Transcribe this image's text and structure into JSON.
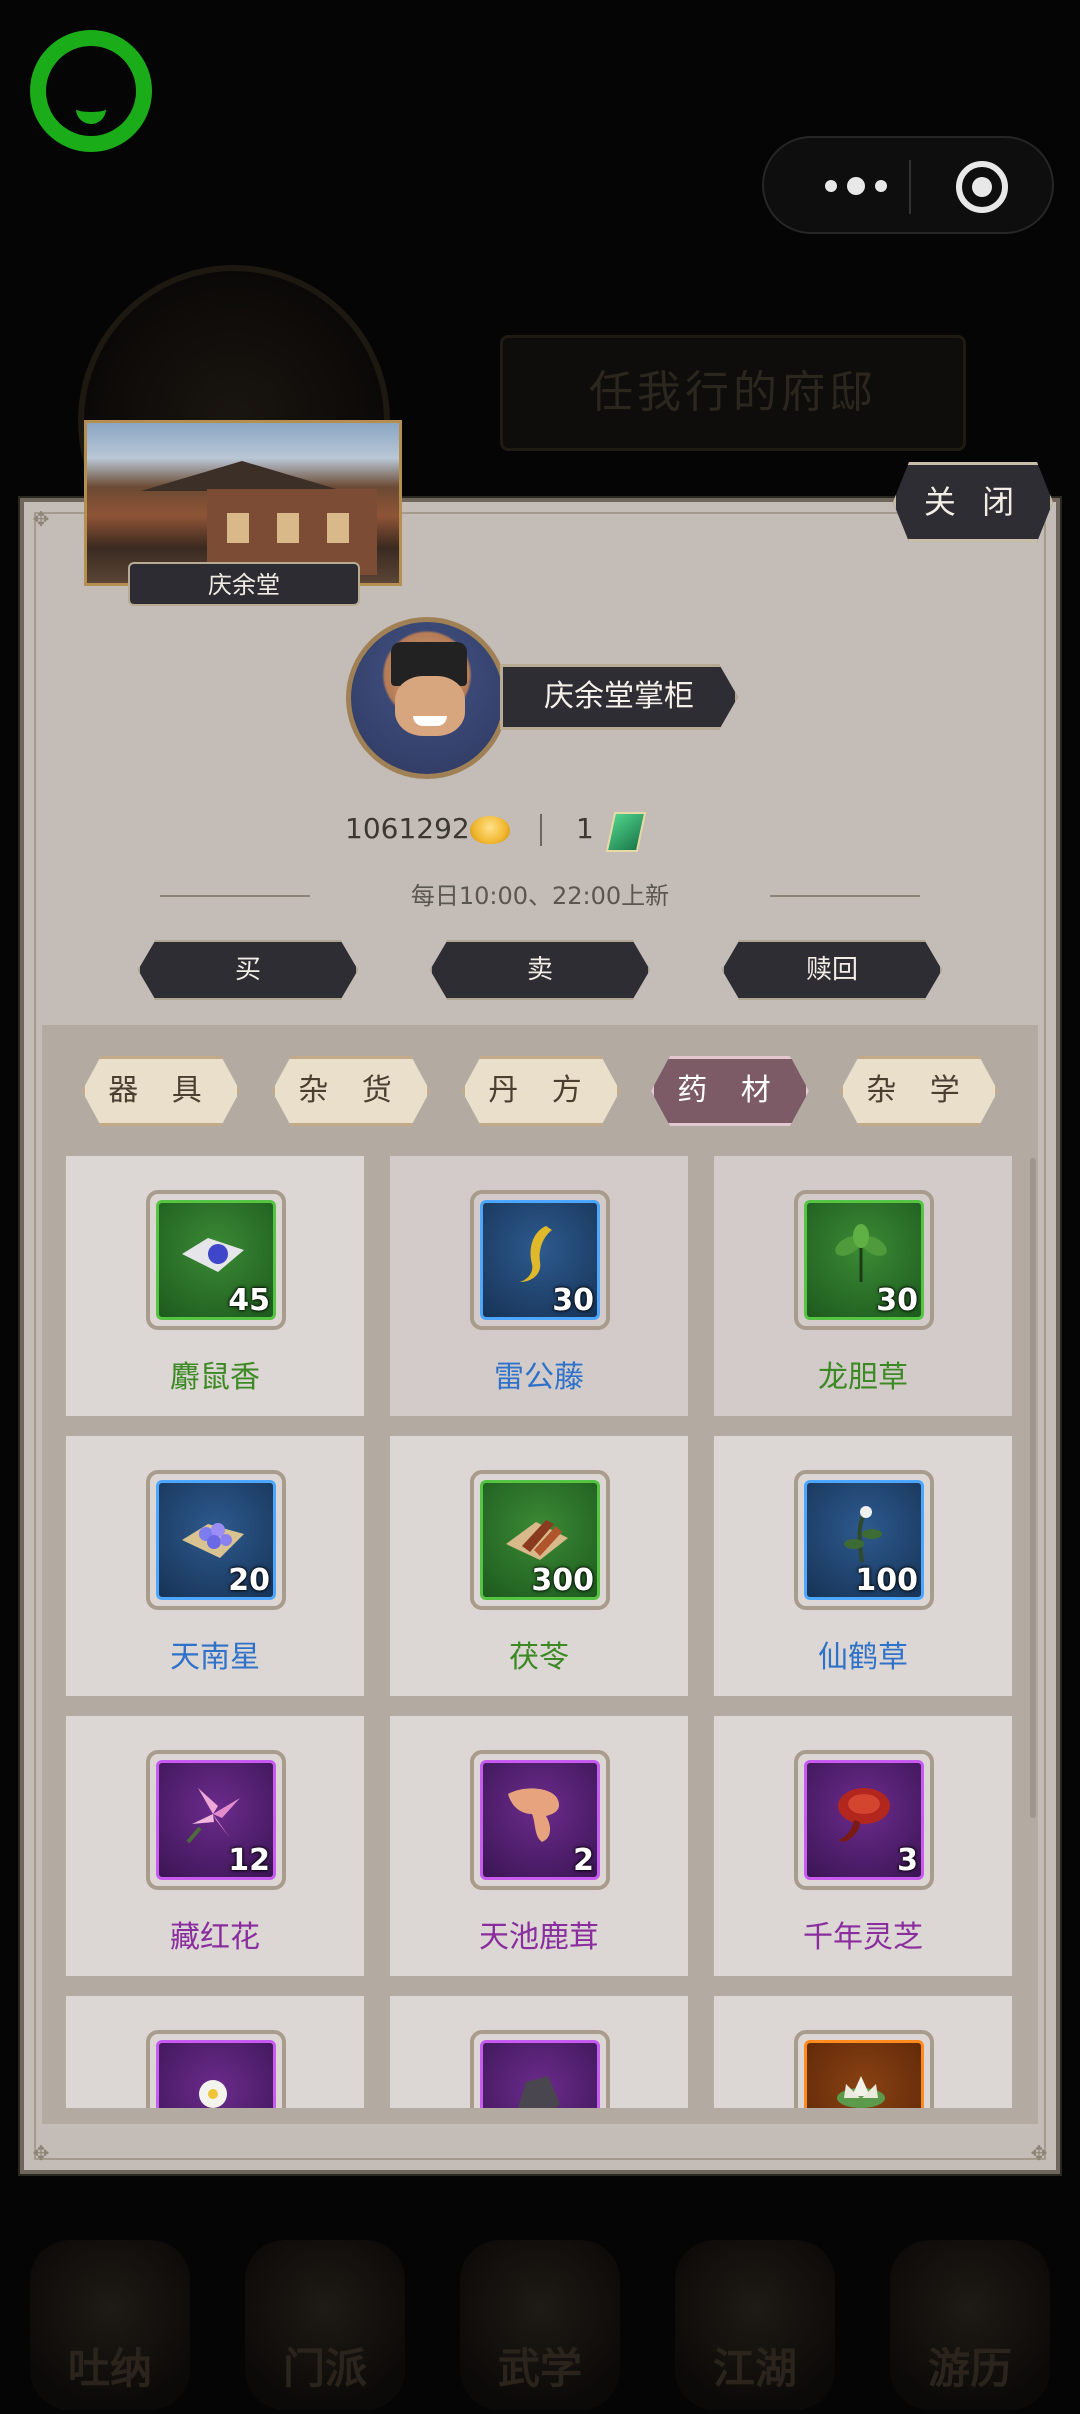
{
  "background": {
    "title": "任我行的府邸",
    "nav": [
      "吐纳",
      "门派",
      "武学",
      "江湖",
      "游历"
    ]
  },
  "shop": {
    "name": "庆余堂",
    "keeper": "庆余堂掌柜",
    "close_label": "关 闭",
    "gold": "1061292",
    "jade": "1",
    "refresh_text": "每日10:00、22:00上新",
    "actions": {
      "buy": "买",
      "sell": "卖",
      "redeem": "赎回"
    },
    "tabs": [
      "器 具",
      "杂 货",
      "丹 方",
      "药 材",
      "杂 学"
    ],
    "active_tab": "药 材",
    "items": [
      {
        "name": "麝鼠香",
        "qty": "45",
        "rarity": "green",
        "icon": "musk-icon"
      },
      {
        "name": "雷公藤",
        "qty": "30",
        "rarity": "blue",
        "icon": "root-icon"
      },
      {
        "name": "龙胆草",
        "qty": "30",
        "rarity": "green",
        "icon": "herb-leaf-icon"
      },
      {
        "name": "天南星",
        "qty": "20",
        "rarity": "blue",
        "icon": "flower-cluster-icon"
      },
      {
        "name": "茯苓",
        "qty": "300",
        "rarity": "green",
        "icon": "fungus-slice-icon"
      },
      {
        "name": "仙鹤草",
        "qty": "100",
        "rarity": "blue",
        "icon": "grass-stem-icon"
      },
      {
        "name": "藏红花",
        "qty": "12",
        "rarity": "purple",
        "icon": "saffron-icon"
      },
      {
        "name": "天池鹿茸",
        "qty": "2",
        "rarity": "purple",
        "icon": "antler-icon"
      },
      {
        "name": "千年灵芝",
        "qty": "3",
        "rarity": "purple",
        "icon": "lingzhi-icon"
      },
      {
        "name": "",
        "qty": "",
        "rarity": "purple",
        "icon": "white-flower-icon"
      },
      {
        "name": "",
        "qty": "",
        "rarity": "purple",
        "icon": "stone-icon"
      },
      {
        "name": "",
        "qty": "",
        "rarity": "orange",
        "icon": "lotus-icon"
      }
    ]
  },
  "colors": {
    "green": "#3c8a23",
    "blue": "#2f72c9",
    "purple": "#8a2d9e",
    "active_tab": "#7c5b67"
  }
}
